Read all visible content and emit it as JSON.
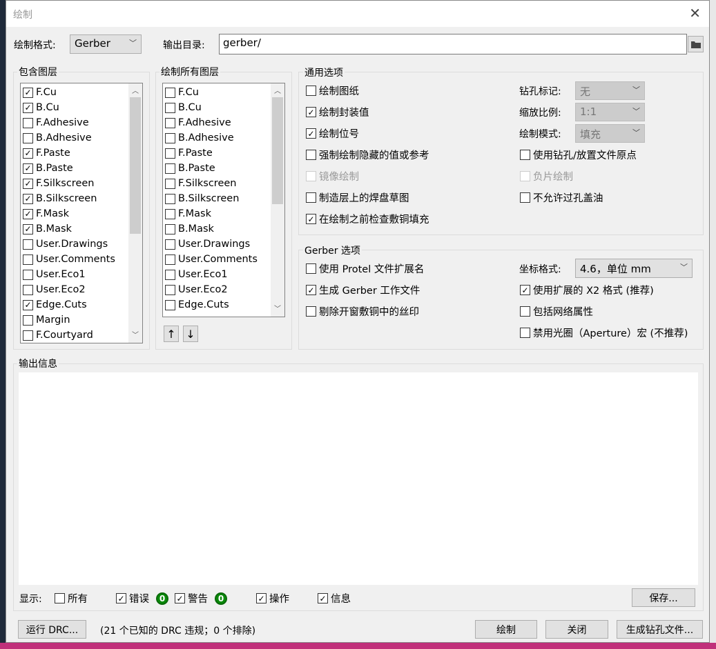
{
  "window": {
    "title": "绘制",
    "close": "✕"
  },
  "top": {
    "format_label": "绘制格式:",
    "format_value": "Gerber",
    "outdir_label": "输出目录:",
    "outdir_value": "gerber/",
    "folder_icon": "folder-icon"
  },
  "include_layers": {
    "title": "包含图层",
    "items": [
      {
        "label": "F.Cu",
        "checked": true
      },
      {
        "label": "B.Cu",
        "checked": true
      },
      {
        "label": "F.Adhesive",
        "checked": false
      },
      {
        "label": "B.Adhesive",
        "checked": false
      },
      {
        "label": "F.Paste",
        "checked": true
      },
      {
        "label": "B.Paste",
        "checked": true
      },
      {
        "label": "F.Silkscreen",
        "checked": true
      },
      {
        "label": "B.Silkscreen",
        "checked": true
      },
      {
        "label": "F.Mask",
        "checked": true
      },
      {
        "label": "B.Mask",
        "checked": true
      },
      {
        "label": "User.Drawings",
        "checked": false
      },
      {
        "label": "User.Comments",
        "checked": false
      },
      {
        "label": "User.Eco1",
        "checked": false
      },
      {
        "label": "User.Eco2",
        "checked": false
      },
      {
        "label": "Edge.Cuts",
        "checked": true
      },
      {
        "label": "Margin",
        "checked": false
      },
      {
        "label": "F.Courtyard",
        "checked": false
      }
    ]
  },
  "all_layers": {
    "title": "绘制所有图层",
    "items": [
      "F.Cu",
      "B.Cu",
      "F.Adhesive",
      "B.Adhesive",
      "F.Paste",
      "B.Paste",
      "F.Silkscreen",
      "B.Silkscreen",
      "F.Mask",
      "B.Mask",
      "User.Drawings",
      "User.Comments",
      "User.Eco1",
      "User.Eco2",
      "Edge.Cuts"
    ],
    "up": "↑",
    "down": "↓"
  },
  "general": {
    "title": "通用选项",
    "left": [
      {
        "label": "绘制图纸",
        "checked": false,
        "disabled": false
      },
      {
        "label": "绘制封装值",
        "checked": true,
        "disabled": false
      },
      {
        "label": "绘制位号",
        "checked": true,
        "disabled": false
      },
      {
        "label": "强制绘制隐藏的值或参考",
        "checked": false,
        "disabled": false
      },
      {
        "label": "镜像绘制",
        "checked": false,
        "disabled": true
      },
      {
        "label": "制造层上的焊盘草图",
        "checked": false,
        "disabled": false
      },
      {
        "label": "在绘制之前检查敷铜填充",
        "checked": true,
        "disabled": false
      }
    ],
    "drill_label": "钻孔标记:",
    "drill_value": "无",
    "scale_label": "缩放比例:",
    "scale_value": "1:1",
    "mode_label": "绘制模式:",
    "mode_value": "填充",
    "right": [
      {
        "label": "使用钻孔/放置文件原点",
        "checked": false,
        "disabled": false
      },
      {
        "label": "负片绘制",
        "checked": false,
        "disabled": true
      },
      {
        "label": "不允许过孔盖油",
        "checked": false,
        "disabled": false
      }
    ]
  },
  "gerber": {
    "title": "Gerber 选项",
    "left": [
      {
        "label": "使用 Protel 文件扩展名",
        "checked": false
      },
      {
        "label": "生成 Gerber 工作文件",
        "checked": true
      },
      {
        "label": "剔除开窗敷铜中的丝印",
        "checked": false
      }
    ],
    "coord_label": "坐标格式:",
    "coord_value": "4.6，单位 mm",
    "right": [
      {
        "label": "使用扩展的 X2 格式 (推荐)",
        "checked": true
      },
      {
        "label": "包括网络属性",
        "checked": false
      },
      {
        "label": "禁用光圈（Aperture）宏 (不推荐)",
        "checked": false
      }
    ]
  },
  "output": {
    "title": "输出信息",
    "show_label": "显示:",
    "filters": [
      {
        "label": "所有",
        "checked": false
      },
      {
        "label": "错误",
        "checked": true,
        "badge": "0"
      },
      {
        "label": "警告",
        "checked": true,
        "badge": "0"
      },
      {
        "label": "操作",
        "checked": true
      },
      {
        "label": "信息",
        "checked": true
      }
    ],
    "save": "保存..."
  },
  "footer": {
    "run_drc": "运行 DRC...",
    "drc_status": "(21 个已知的 DRC 违规；0 个排除)",
    "plot": "绘制",
    "close": "关闭",
    "gen_drill": "生成钻孔文件..."
  }
}
